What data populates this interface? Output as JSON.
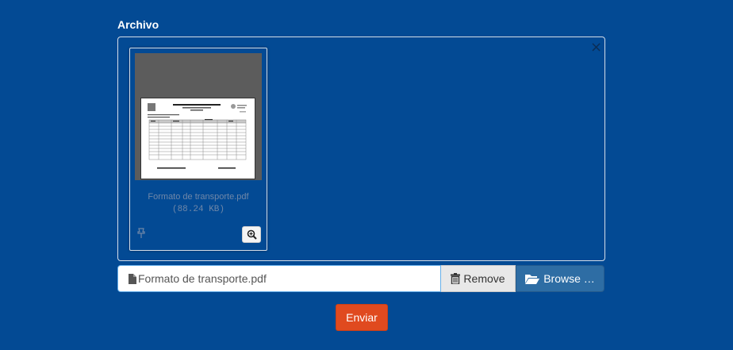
{
  "form": {
    "field_label": "Archivo",
    "submit_label": "Enviar"
  },
  "preview": {
    "close_symbol": "×",
    "file_name": "Formato de transporte.pdf",
    "file_size": "(88.24 KB)",
    "icons": {
      "close": "close-icon",
      "drag": "drag-handle-icon",
      "zoom": "zoom-in-icon"
    }
  },
  "file_input": {
    "caption": "Formato de transporte.pdf",
    "remove_label": "Remove",
    "browse_label": "Browse …",
    "icons": {
      "caption": "file-icon",
      "remove": "trash-icon",
      "browse": "folder-open-icon"
    }
  },
  "colors": {
    "page_background": "#034a94",
    "submit_button": "#e04a1f",
    "browse_button": "#2e6da4"
  }
}
